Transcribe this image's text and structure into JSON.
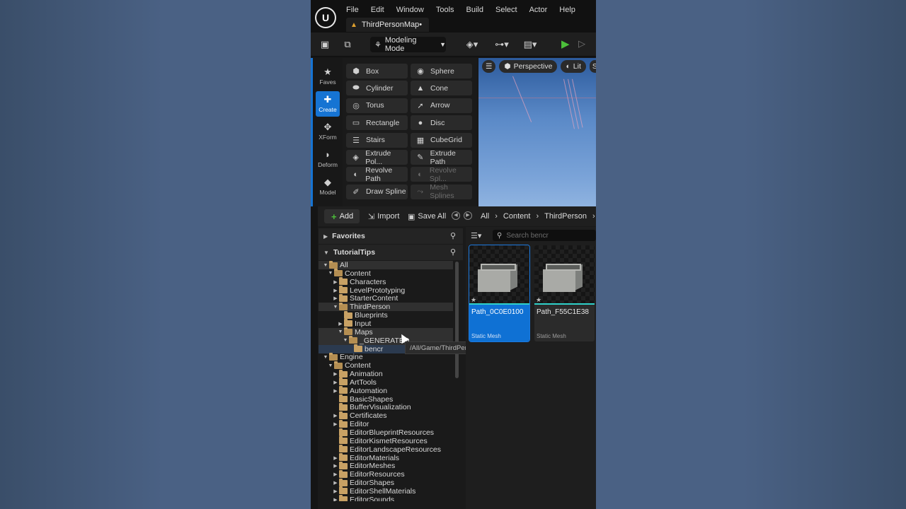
{
  "menu": [
    "File",
    "Edit",
    "Window",
    "Tools",
    "Build",
    "Select",
    "Actor",
    "Help"
  ],
  "tab": {
    "title": "ThirdPersonMap•"
  },
  "toolbar": {
    "mode_label": "Modeling Mode"
  },
  "categories": [
    {
      "label": "Faves",
      "icon": "★",
      "active": false
    },
    {
      "label": "Create",
      "icon": "✚",
      "active": true
    },
    {
      "label": "XForm",
      "icon": "✥",
      "active": false
    },
    {
      "label": "Deform",
      "icon": "◗",
      "active": false
    },
    {
      "label": "Model",
      "icon": "◆",
      "active": false
    }
  ],
  "tools": [
    {
      "label": "Box",
      "icon": "⬢",
      "disabled": false
    },
    {
      "label": "Sphere",
      "icon": "◉",
      "disabled": false
    },
    {
      "label": "Cylinder",
      "icon": "⬬",
      "disabled": false
    },
    {
      "label": "Cone",
      "icon": "▲",
      "disabled": false
    },
    {
      "label": "Torus",
      "icon": "◎",
      "disabled": false
    },
    {
      "label": "Arrow",
      "icon": "➚",
      "disabled": false
    },
    {
      "label": "Rectangle",
      "icon": "▭",
      "disabled": false
    },
    {
      "label": "Disc",
      "icon": "●",
      "disabled": false
    },
    {
      "label": "Stairs",
      "icon": "☰",
      "disabled": false
    },
    {
      "label": "CubeGrid",
      "icon": "▦",
      "disabled": false
    },
    {
      "label": "Extrude Pol...",
      "icon": "◈",
      "disabled": false
    },
    {
      "label": "Extrude Path",
      "icon": "✎",
      "disabled": false
    },
    {
      "label": "Revolve Path",
      "icon": "◐",
      "disabled": false
    },
    {
      "label": "Revolve Spl...",
      "icon": "◐",
      "disabled": true
    },
    {
      "label": "Draw Spline",
      "icon": "✐",
      "disabled": false
    },
    {
      "label": "Mesh Splines",
      "icon": "⤳",
      "disabled": true
    }
  ],
  "viewport": {
    "view_label": "Perspective",
    "lit_label": "Lit",
    "extra_label": "S"
  },
  "content_browser": {
    "add_label": "Add",
    "import_label": "Import",
    "save_all_label": "Save All",
    "breadcrumbs": [
      "All",
      "Content",
      "ThirdPerson"
    ],
    "favorites_label": "Favorites",
    "project_label": "TutorialTips",
    "search_placeholder": "Search bencr",
    "tooltip": "/All/Game/ThirdPerson/Maps"
  },
  "tree": [
    {
      "label": "All",
      "depth": 0,
      "expander": "▼",
      "open": true,
      "sel": "row"
    },
    {
      "label": "Content",
      "depth": 1,
      "expander": "▼",
      "open": true,
      "sel": ""
    },
    {
      "label": "Characters",
      "depth": 2,
      "expander": "▶",
      "open": false,
      "sel": ""
    },
    {
      "label": "LevelPrototyping",
      "depth": 2,
      "expander": "▶",
      "open": false,
      "sel": ""
    },
    {
      "label": "StarterContent",
      "depth": 2,
      "expander": "▶",
      "open": false,
      "sel": ""
    },
    {
      "label": "ThirdPerson",
      "depth": 2,
      "expander": "▼",
      "open": true,
      "sel": "row"
    },
    {
      "label": "Blueprints",
      "depth": 3,
      "expander": "",
      "open": false,
      "sel": ""
    },
    {
      "label": "Input",
      "depth": 3,
      "expander": "▶",
      "open": false,
      "sel": ""
    },
    {
      "label": "Maps",
      "depth": 3,
      "expander": "▼",
      "open": true,
      "sel": "row"
    },
    {
      "label": "_GENERATED",
      "depth": 4,
      "expander": "▼",
      "open": true,
      "sel": "row"
    },
    {
      "label": "bencr",
      "depth": 5,
      "expander": "",
      "open": false,
      "sel": "sel"
    },
    {
      "label": "Engine",
      "depth": 0,
      "expander": "▼",
      "open": true,
      "sel": ""
    },
    {
      "label": "Content",
      "depth": 1,
      "expander": "▼",
      "open": true,
      "sel": ""
    },
    {
      "label": "Animation",
      "depth": 2,
      "expander": "▶",
      "open": false,
      "sel": ""
    },
    {
      "label": "ArtTools",
      "depth": 2,
      "expander": "▶",
      "open": false,
      "sel": ""
    },
    {
      "label": "Automation",
      "depth": 2,
      "expander": "▶",
      "open": false,
      "sel": ""
    },
    {
      "label": "BasicShapes",
      "depth": 2,
      "expander": "",
      "open": false,
      "sel": ""
    },
    {
      "label": "BufferVisualization",
      "depth": 2,
      "expander": "",
      "open": false,
      "sel": ""
    },
    {
      "label": "Certificates",
      "depth": 2,
      "expander": "▶",
      "open": false,
      "sel": ""
    },
    {
      "label": "Editor",
      "depth": 2,
      "expander": "▶",
      "open": false,
      "sel": ""
    },
    {
      "label": "EditorBlueprintResources",
      "depth": 2,
      "expander": "",
      "open": false,
      "sel": ""
    },
    {
      "label": "EditorKismetResources",
      "depth": 2,
      "expander": "",
      "open": false,
      "sel": ""
    },
    {
      "label": "EditorLandscapeResources",
      "depth": 2,
      "expander": "",
      "open": false,
      "sel": ""
    },
    {
      "label": "EditorMaterials",
      "depth": 2,
      "expander": "▶",
      "open": false,
      "sel": ""
    },
    {
      "label": "EditorMeshes",
      "depth": 2,
      "expander": "▶",
      "open": false,
      "sel": ""
    },
    {
      "label": "EditorResources",
      "depth": 2,
      "expander": "▶",
      "open": false,
      "sel": ""
    },
    {
      "label": "EditorShapes",
      "depth": 2,
      "expander": "▶",
      "open": false,
      "sel": ""
    },
    {
      "label": "EditorShellMaterials",
      "depth": 2,
      "expander": "▶",
      "open": false,
      "sel": ""
    },
    {
      "label": "EditorSounds",
      "depth": 2,
      "expander": "▶",
      "open": false,
      "sel": ""
    }
  ],
  "assets": [
    {
      "name": "Path_0C0E0100",
      "type": "Static Mesh",
      "selected": true
    },
    {
      "name": "Path_F55C1E38",
      "type": "Static Mesh",
      "selected": false
    }
  ]
}
